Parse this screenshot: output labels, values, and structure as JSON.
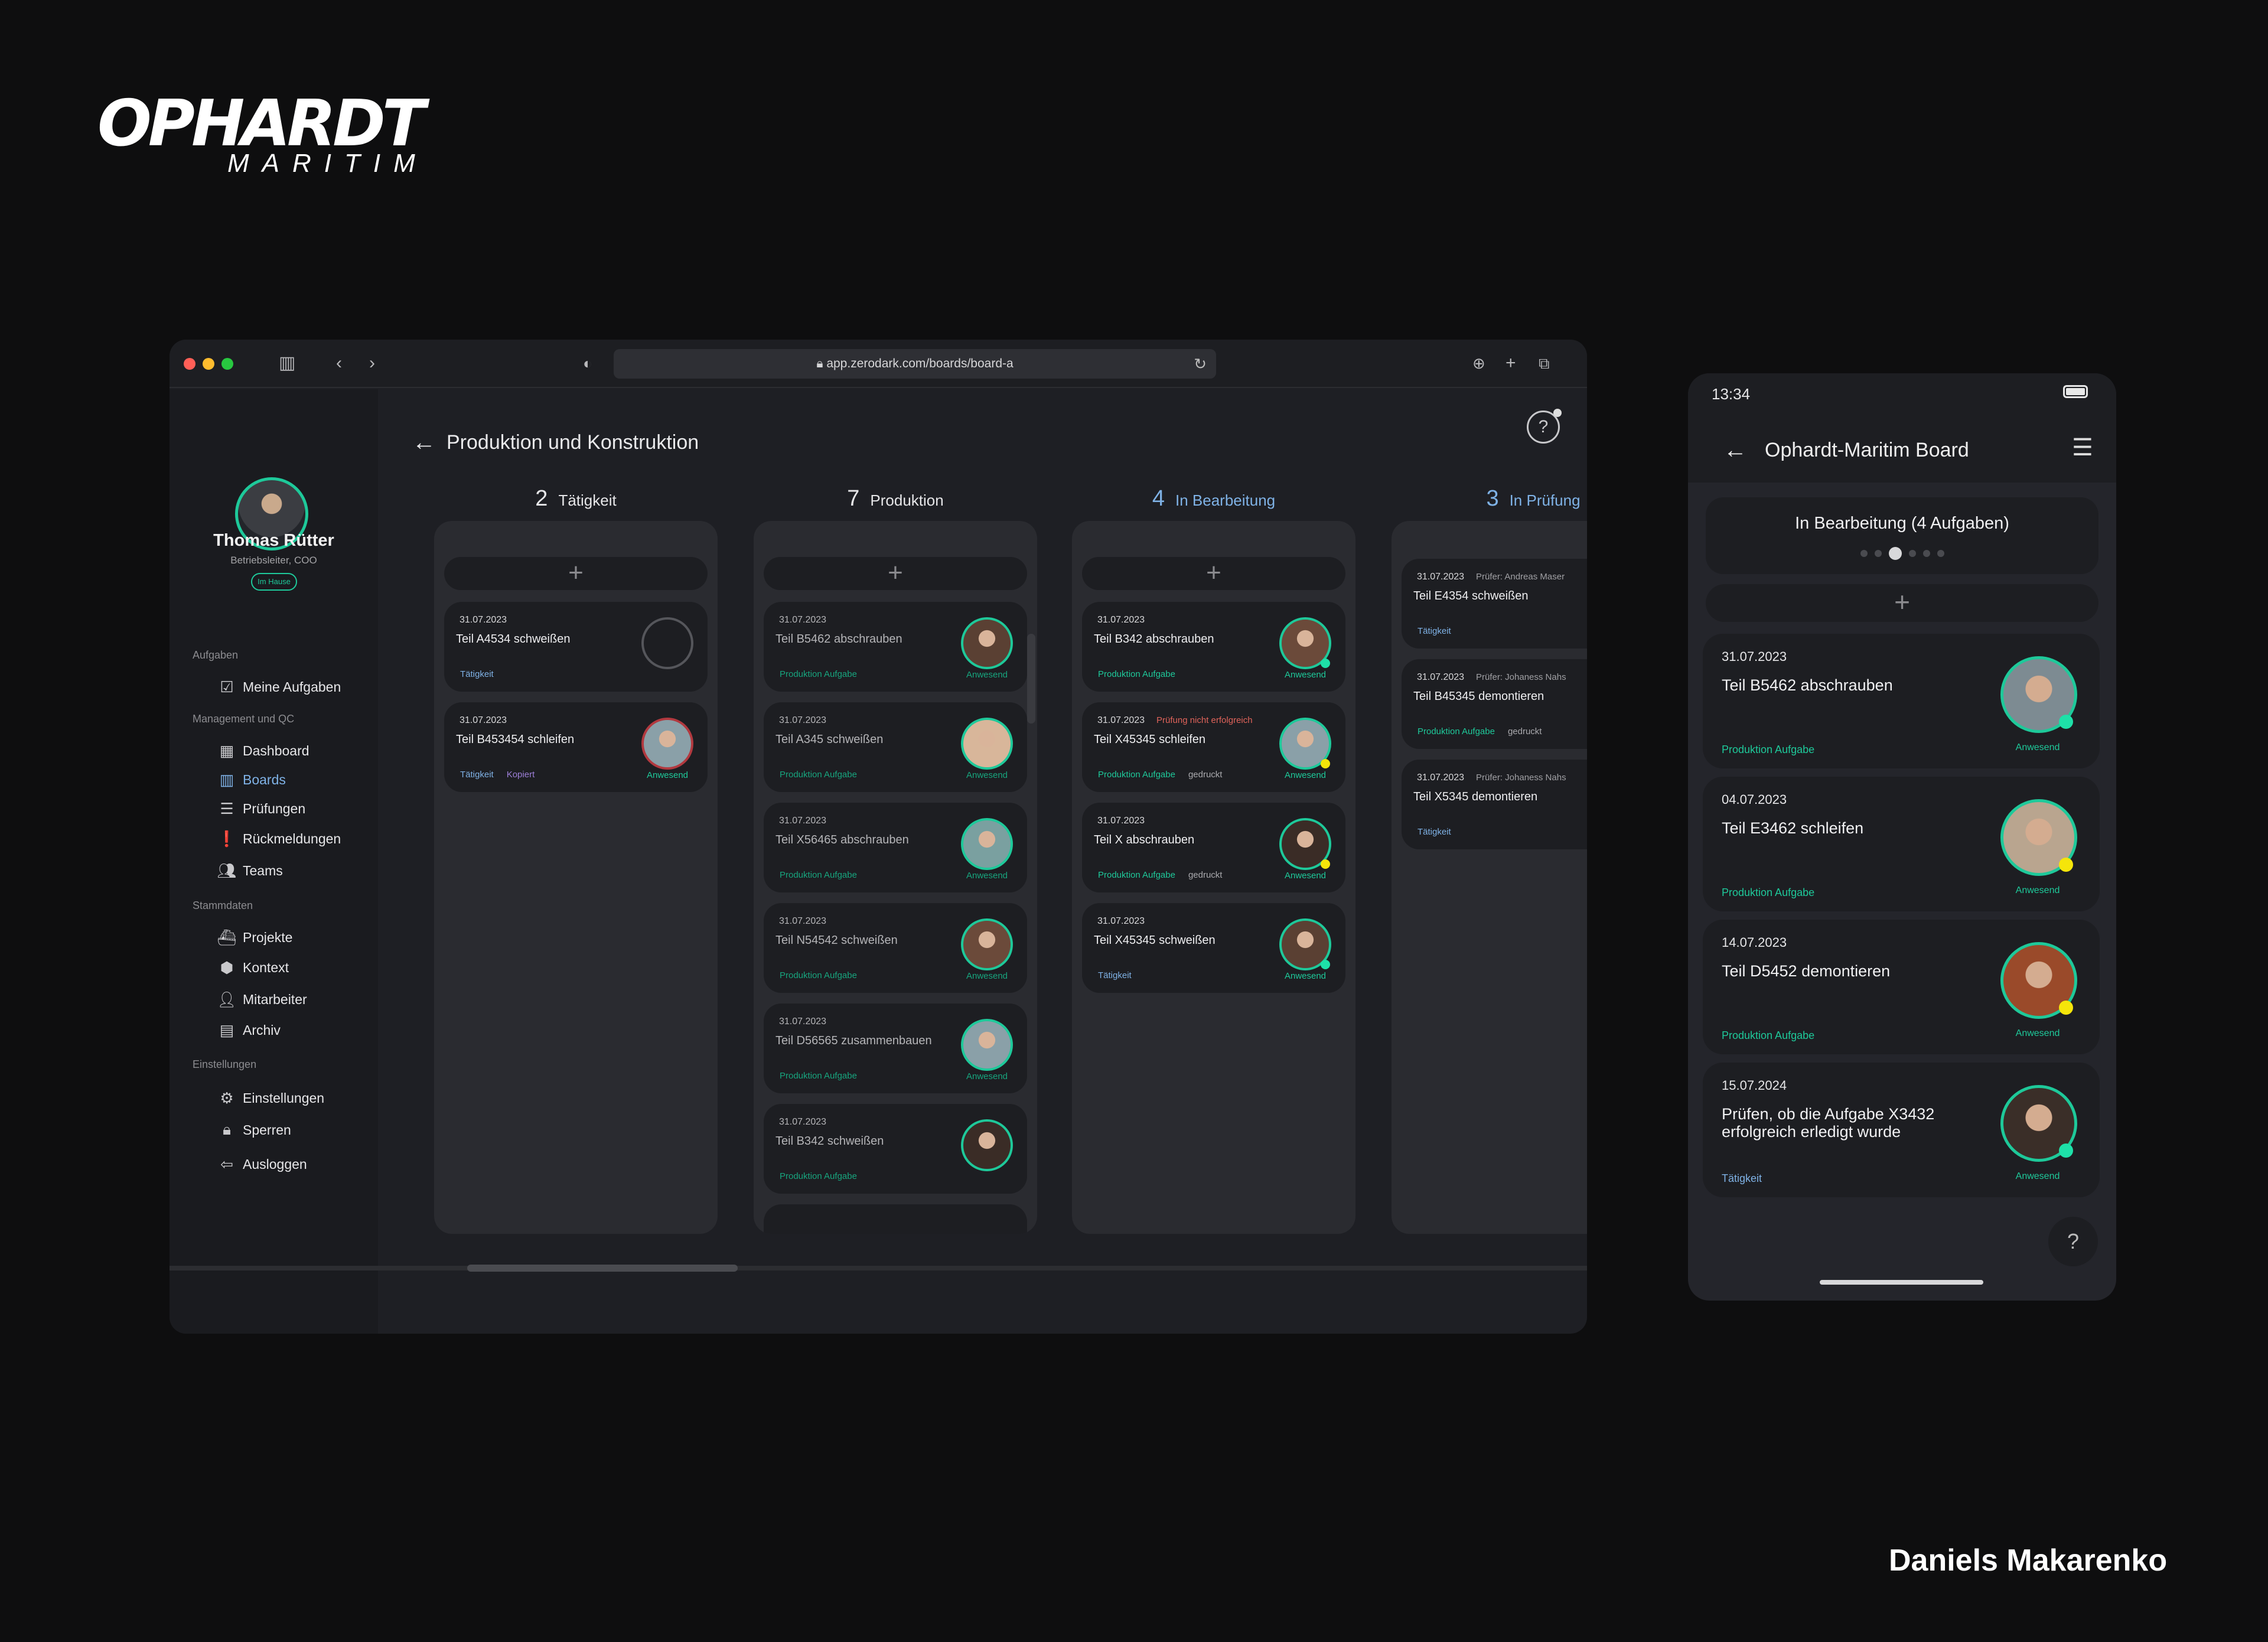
{
  "brand": {
    "logo_main": "OPHARDT",
    "logo_sub": "MARITIM"
  },
  "author": "Daniels Makarenko",
  "colors": {
    "accent_green": "#1ec99a",
    "accent_blue": "#7fb2e6",
    "error_red": "#e0635a",
    "status_yellow": "#f5e50a"
  },
  "browser": {
    "url": "app.zerodark.com/boards/board-a"
  },
  "user": {
    "name": "Thomas Rütter",
    "role": "Betriebsleiter, COO",
    "status": "Im Hause"
  },
  "sidebar": {
    "sections": [
      {
        "label": "Aufgaben",
        "items": [
          {
            "label": "Meine Aufgaben",
            "icon": "tasks-icon"
          }
        ]
      },
      {
        "label": "Management und QC",
        "items": [
          {
            "label": "Dashboard",
            "icon": "dashboard-icon"
          },
          {
            "label": "Boards",
            "icon": "boards-icon",
            "active": true
          },
          {
            "label": "Prüfungen",
            "icon": "checklist-icon"
          },
          {
            "label": "Rückmeldungen",
            "icon": "feedback-icon"
          },
          {
            "label": "Teams",
            "icon": "team-icon"
          }
        ]
      },
      {
        "label": "Stammdaten",
        "items": [
          {
            "label": "Projekte",
            "icon": "ship-icon"
          },
          {
            "label": "Kontext",
            "icon": "cubes-icon"
          },
          {
            "label": "Mitarbeiter",
            "icon": "employee-icon"
          },
          {
            "label": "Archiv",
            "icon": "archive-icon"
          }
        ]
      },
      {
        "label": "Einstellungen",
        "items": [
          {
            "label": "Einstellungen",
            "icon": "gear-icon"
          },
          {
            "label": "Sperren",
            "icon": "lock-icon"
          },
          {
            "label": "Ausloggen",
            "icon": "logout-icon"
          }
        ]
      }
    ]
  },
  "board": {
    "title": "Produktion und Konstruktion",
    "columns": [
      {
        "count": "2",
        "name": "Tätigkeit",
        "cards": [
          {
            "date": "31.07.2023",
            "title": "Teil A4534 schweißen",
            "tags": [
              {
                "t": "Tätigkeit",
                "c": "blue"
              }
            ],
            "avatar": "empty"
          },
          {
            "date": "31.07.2023",
            "title": "Teil B453454 schleifen",
            "tags": [
              {
                "t": "Tätigkeit",
                "c": "blue"
              },
              {
                "t": "Kopiert",
                "c": "purple"
              }
            ],
            "avatar": "red",
            "presence": "Anwesend"
          }
        ]
      },
      {
        "count": "7",
        "name": "Produktion",
        "cards": [
          {
            "date": "31.07.2023",
            "title": "Teil B5462 abschrauben",
            "tags": [
              {
                "t": "Produktion Aufgabe",
                "c": "green"
              }
            ],
            "avatar": "green",
            "presence": "Anwesend"
          },
          {
            "date": "31.07.2023",
            "title": "Teil A345 schweißen",
            "tags": [
              {
                "t": "Produktion Aufgabe",
                "c": "green"
              }
            ],
            "avatar": "green",
            "presence": "Anwesend"
          },
          {
            "date": "31.07.2023",
            "title": "Teil X56465 abschrauben",
            "tags": [
              {
                "t": "Produktion Aufgabe",
                "c": "green"
              }
            ],
            "avatar": "green",
            "presence": "Anwesend"
          },
          {
            "date": "31.07.2023",
            "title": "Teil N54542 schweißen",
            "tags": [
              {
                "t": "Produktion Aufgabe",
                "c": "green"
              }
            ],
            "avatar": "green",
            "presence": "Anwesend"
          },
          {
            "date": "31.07.2023",
            "title": "Teil D56565 zusammenbauen",
            "tags": [
              {
                "t": "Produktion Aufgabe",
                "c": "green"
              }
            ],
            "avatar": "green",
            "presence": "Anwesend"
          },
          {
            "date": "31.07.2023",
            "title": "Teil B342 schweißen",
            "tags": [
              {
                "t": "Produktion Aufgabe",
                "c": "green"
              }
            ],
            "avatar": "green"
          }
        ]
      },
      {
        "count": "4",
        "name": "In Bearbeitung",
        "highlight": true,
        "cards": [
          {
            "date": "31.07.2023",
            "title": "Teil B342 abschrauben",
            "tags": [
              {
                "t": "Produktion Aufgabe",
                "c": "green"
              }
            ],
            "avatar": "green",
            "dot": "#1ee0a8",
            "presence": "Anwesend"
          },
          {
            "date": "31.07.2023",
            "note": "Prüfung nicht erfolgreich",
            "note_fail": true,
            "title": "Teil X45345 schleifen",
            "tags": [
              {
                "t": "Produktion Aufgabe",
                "c": "green"
              },
              {
                "t": "gedruckt",
                "c": "gray"
              }
            ],
            "avatar": "green",
            "dot": "#f5e50a",
            "presence": "Anwesend"
          },
          {
            "date": "31.07.2023",
            "title": "Teil X abschrauben",
            "tags": [
              {
                "t": "Produktion Aufgabe",
                "c": "green"
              },
              {
                "t": "gedruckt",
                "c": "gray"
              }
            ],
            "avatar": "green",
            "dot": "#f5e50a",
            "presence": "Anwesend"
          },
          {
            "date": "31.07.2023",
            "title": "Teil X45345 schweißen",
            "tags": [
              {
                "t": "Tätigkeit",
                "c": "blue"
              }
            ],
            "avatar": "green",
            "dot": "#1ee0a8",
            "presence": "Anwesend"
          }
        ]
      },
      {
        "count": "3",
        "name": "In Prüfung",
        "highlight": true,
        "cards": [
          {
            "date": "31.07.2023",
            "note": "Prüfer:  Andreas Maser",
            "title": "Teil E4354 schweißen",
            "tags": [
              {
                "t": "Tätigkeit",
                "c": "blue"
              }
            ]
          },
          {
            "date": "31.07.2023",
            "note": "Prüfer:  Johaness Nahs",
            "title": "Teil B45345 demontieren",
            "tags": [
              {
                "t": "Produktion Aufgabe",
                "c": "green"
              },
              {
                "t": "gedruckt",
                "c": "gray"
              }
            ]
          },
          {
            "date": "31.07.2023",
            "note": "Prüfer:  Johaness Nahs",
            "title": "Teil X5345 demontieren",
            "tags": [
              {
                "t": "Tätigkeit",
                "c": "blue"
              }
            ]
          }
        ]
      }
    ]
  },
  "phone": {
    "time": "13:34",
    "title": "Ophardt-Maritim Board",
    "column_title": "In Bearbeitung (4 Aufgaben)",
    "page_count": 6,
    "page_active": 3,
    "cards": [
      {
        "date": "31.07.2023",
        "title": "Teil B5462 abschrauben",
        "tag": "Produktion Aufgabe",
        "tag_color": "green",
        "dot": "#1ee0a8",
        "presence": "Anwesend"
      },
      {
        "date": "04.07.2023",
        "title": "Teil E3462 schleifen",
        "tag": "Produktion Aufgabe",
        "tag_color": "green",
        "dot": "#f5e50a",
        "presence": "Anwesend"
      },
      {
        "date": "14.07.2023",
        "title": "Teil D5452 demontieren",
        "tag": "Produktion Aufgabe",
        "tag_color": "green",
        "dot": "#f5e50a",
        "presence": "Anwesend"
      },
      {
        "date": "15.07.2024",
        "title": "Prüfen, ob die Aufgabe X3432 erfolgreich erledigt wurde",
        "tag": "Tätigkeit",
        "tag_color": "blue",
        "dot": "#1ee0a8",
        "presence": "Anwesend"
      }
    ]
  }
}
